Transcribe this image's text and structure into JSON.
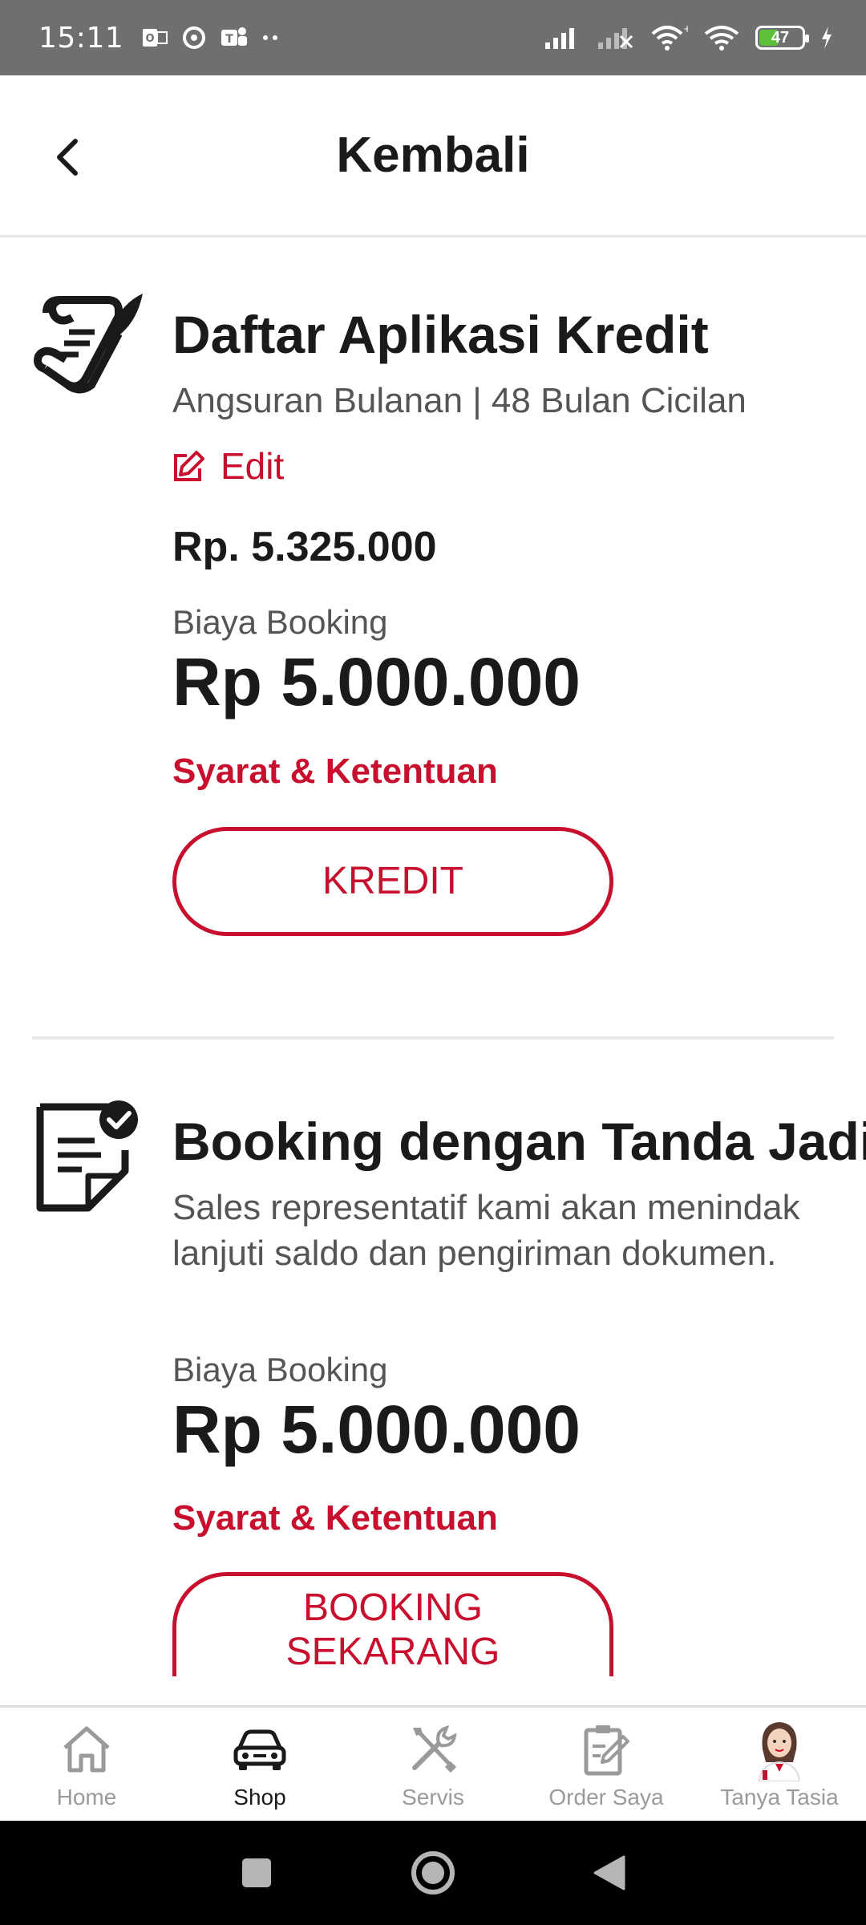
{
  "status_bar": {
    "time": "15:11",
    "battery_level": "47"
  },
  "header": {
    "title": "Kembali"
  },
  "credit_card": {
    "title": "Daftar Aplikasi Kredit",
    "subtitle": "Angsuran Bulanan | 48 Bulan Cicilan",
    "edit_label": "Edit",
    "price": "Rp. 5.325.000",
    "booking_label": "Biaya Booking",
    "booking_amount": "Rp 5.000.000",
    "terms_label": "Syarat & Ketentuan",
    "button_label": "KREDIT"
  },
  "booking_card": {
    "title": "Booking dengan Tanda Jadi",
    "description": "Sales representatif kami akan menindak lanjuti saldo dan pengiriman dokumen.",
    "booking_label": "Biaya Booking",
    "booking_amount": "Rp 5.000.000",
    "terms_label": "Syarat & Ketentuan",
    "button_line1": "BOOKING",
    "button_line2": "SEKARANG"
  },
  "bottom_nav": {
    "items": [
      {
        "label": "Home",
        "icon": "home-icon",
        "active": false
      },
      {
        "label": "Shop",
        "icon": "car-icon",
        "active": true
      },
      {
        "label": "Servis",
        "icon": "tools-icon",
        "active": false
      },
      {
        "label": "Order Saya",
        "icon": "clipboard-icon",
        "active": false
      },
      {
        "label": "Tanya Tasia",
        "icon": "assistant-avatar",
        "active": false
      }
    ]
  },
  "colors": {
    "accent": "#c8102e",
    "status_bar": "#6f6f6f",
    "battery": "#5cc03a"
  }
}
